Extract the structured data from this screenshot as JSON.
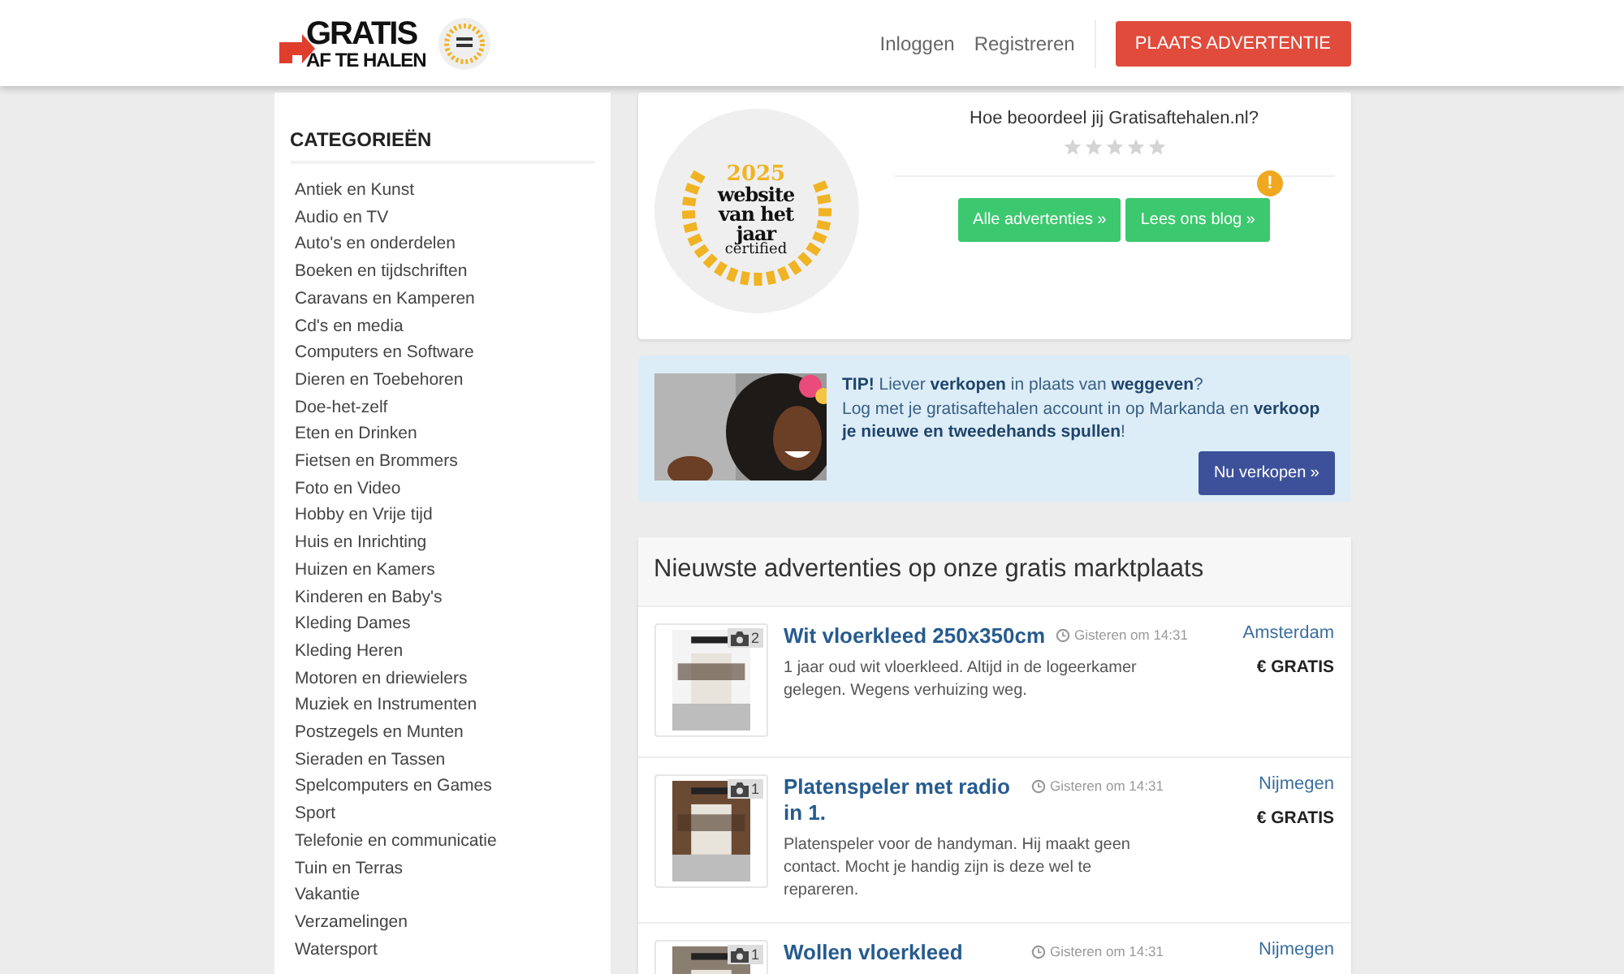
{
  "header": {
    "logo_top": "GRATIS",
    "logo_bottom": "AF TE HALEN",
    "nav": [
      "Inloggen",
      "Registreren"
    ],
    "cta": "PLAATS ADVERTENTIE"
  },
  "sidebar": {
    "title": "CATEGORIEËN",
    "items": [
      "Antiek en Kunst",
      "Audio en TV",
      "Auto's en onderdelen",
      "Boeken en tijdschriften",
      "Caravans en Kamperen",
      "Cd's en media",
      "Computers en Software",
      "Dieren en Toebehoren",
      "Doe-het-zelf",
      "Eten en Drinken",
      "Fietsen en Brommers",
      "Foto en Video",
      "Hobby en Vrije tijd",
      "Huis en Inrichting",
      "Huizen en Kamers",
      "Kinderen en Baby's",
      "Kleding Dames",
      "Kleding Heren",
      "Motoren en driewielers",
      "Muziek en Instrumenten",
      "Postzegels en Munten",
      "Sieraden en Tassen",
      "Spelcomputers en Games",
      "Sport",
      "Telefonie en communicatie",
      "Tuin en Terras",
      "Vakantie",
      "Verzamelingen",
      "Watersport"
    ]
  },
  "award": {
    "year": "2025",
    "line1": "website",
    "line2": "van het",
    "line3": "jaar",
    "line4": "certified"
  },
  "rating": {
    "question": "Hoe beoordeel jij Gratisaftehalen.nl?",
    "stars": 0
  },
  "buttons": [
    {
      "label": "Alle advertenties »"
    },
    {
      "label": "Lees ons blog »",
      "badge": "!"
    }
  ],
  "tip": {
    "text": "**TIP!** Liever **verkopen** in plaats van **weggeven**?\nLog met je gratisaftehalen account in op Markanda en **verkoop je nieuwe en tweedehands spullen**!",
    "button": "Nu verkopen »"
  },
  "listings_title": "Nieuwste advertenties op onze gratis marktplaats",
  "listings": [
    {
      "title": "Wit vloerkleed 250x350cm",
      "photos": "2",
      "time": "Gisteren om 14:31",
      "location": "Amsterdam",
      "price": "€ GRATIS",
      "description": "1 jaar oud wit vloerkleed. Altijd in de logeerkamer gelegen. Wegens verhuizing weg."
    },
    {
      "title": "Platenspeler met radio in 1.",
      "photos": "1",
      "time": "Gisteren om 14:31",
      "location": "Nijmegen",
      "price": "€ GRATIS",
      "description": "Platenspeler voor de handyman. Hij maakt geen contact. Mocht je handig zijn is deze wel te repareren."
    },
    {
      "title": "Wollen vloerkleed",
      "photos": "1",
      "time": "Gisteren om 14:31",
      "location": "Nijmegen"
    }
  ]
}
